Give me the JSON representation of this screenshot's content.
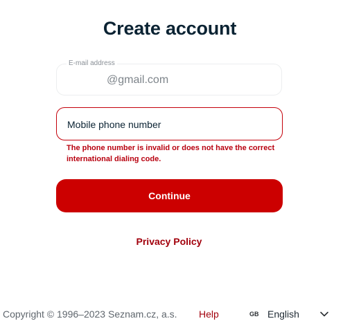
{
  "page": {
    "title": "Create account"
  },
  "email": {
    "label": "E-mail address",
    "value": "@gmail.com"
  },
  "phone": {
    "placeholder": "Mobile phone number",
    "error": "The phone number is invalid or does not have the correct international dialing code."
  },
  "actions": {
    "continue_label": "Continue",
    "privacy_label": "Privacy Policy"
  },
  "footer": {
    "copyright": "Copyright © 1996–2023 Seznam.cz, a.s.",
    "help_label": "Help",
    "language_code": "GB",
    "language_name": "English",
    "chevron_icon": "chevron-down-icon"
  },
  "colors": {
    "brand_red": "#cc0000",
    "error_red": "#b8000f",
    "title_dark": "#0b2333"
  }
}
